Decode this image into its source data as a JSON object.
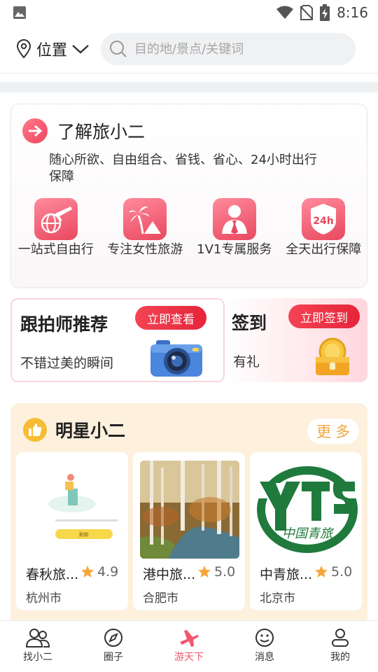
{
  "status_bar": {
    "time": "8:16"
  },
  "header": {
    "location_label": "位置",
    "search_placeholder": "目的地/景点/关键词"
  },
  "about": {
    "title": "了解旅小二",
    "description": "随心所欲、自由组合、省钱、省心、24小时出行保障",
    "features": [
      {
        "label": "一站式自由行",
        "icon": "airplane-globe-icon"
      },
      {
        "label": "专注女性旅游",
        "icon": "palm-tree-icon"
      },
      {
        "label": "1V1专属服务",
        "icon": "service-person-icon"
      },
      {
        "label": "全天出行保障",
        "icon": "24h-shield-icon"
      }
    ],
    "badge_24h": "24h"
  },
  "promos": {
    "photographer": {
      "title": "跟拍师推荐",
      "subtitle": "不错过美的瞬间",
      "button": "立即查看"
    },
    "checkin": {
      "title": "签到",
      "subtitle": "有礼",
      "button": "立即签到"
    }
  },
  "stars_section": {
    "title": "明星小二",
    "more": "更多",
    "agencies": [
      {
        "name": "春秋旅...",
        "rating": "4.9",
        "city": "杭州市",
        "image": "app-placeholder",
        "placeholder_button": "刷新"
      },
      {
        "name": "港中旅...",
        "rating": "5.0",
        "city": "合肥市",
        "image": "forest-painting"
      },
      {
        "name": "中青旅...",
        "rating": "5.0",
        "city": "北京市",
        "image": "cyts-logo",
        "logo_text": "中国青旅"
      }
    ]
  },
  "bottom_nav": [
    {
      "label": "找小二",
      "icon": "people-icon",
      "active": false
    },
    {
      "label": "圈子",
      "icon": "compass-icon",
      "active": false
    },
    {
      "label": "游天下",
      "icon": "airplane-icon",
      "active": true
    },
    {
      "label": "消息",
      "icon": "smiley-icon",
      "active": false
    },
    {
      "label": "我的",
      "icon": "user-icon",
      "active": false
    }
  ],
  "colors": {
    "accent_red": "#f0455e",
    "button_red": "#e6243a",
    "stars_bg": "#fdf0dc",
    "more_text": "#f0a640",
    "star": "#f6a53a",
    "nav_active": "#f2566c"
  }
}
